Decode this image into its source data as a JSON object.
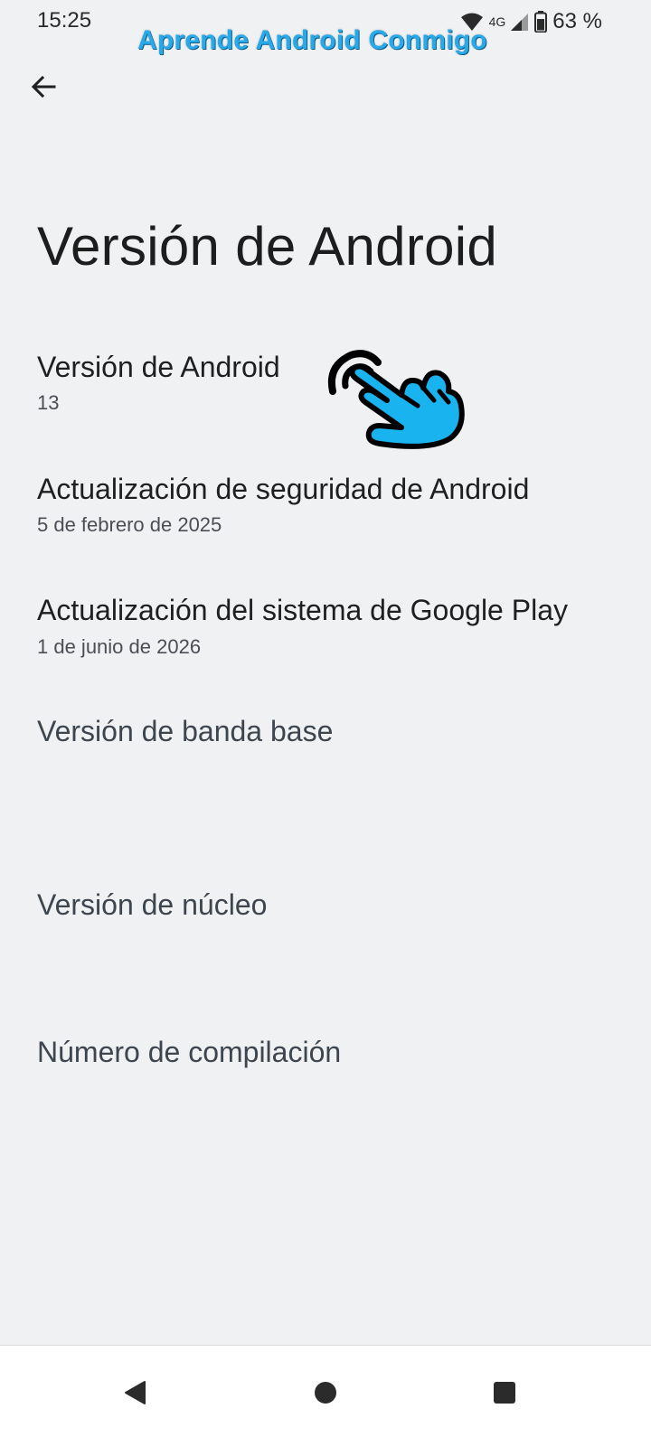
{
  "status_bar": {
    "time": "15:25",
    "network": "4G",
    "battery": "63 %",
    "icons": [
      "wifi-icon",
      "signal-icon",
      "battery-icon"
    ]
  },
  "watermark": "Aprende Android Conmigo",
  "header": {
    "back_icon": "arrow-left-icon",
    "title": "Versión de Android"
  },
  "items": [
    {
      "title": "Versión de Android",
      "subtitle": "13"
    },
    {
      "title": "Actualización de seguridad de Android",
      "subtitle": "5 de febrero de 2025"
    },
    {
      "title": "Actualización del sistema de Google Play",
      "subtitle": "1 de junio de 2026"
    },
    {
      "title": "Versión de banda base",
      "subtitle": ""
    },
    {
      "title": "Versión de núcleo",
      "subtitle": ""
    },
    {
      "title": "Número de compilación",
      "subtitle": ""
    }
  ],
  "overlay": {
    "icon": "pointing-hand-icon",
    "color": "#19b3f0"
  },
  "nav_bar": {
    "icons": [
      "back-triangle-icon",
      "home-circle-icon",
      "recents-square-icon"
    ]
  }
}
